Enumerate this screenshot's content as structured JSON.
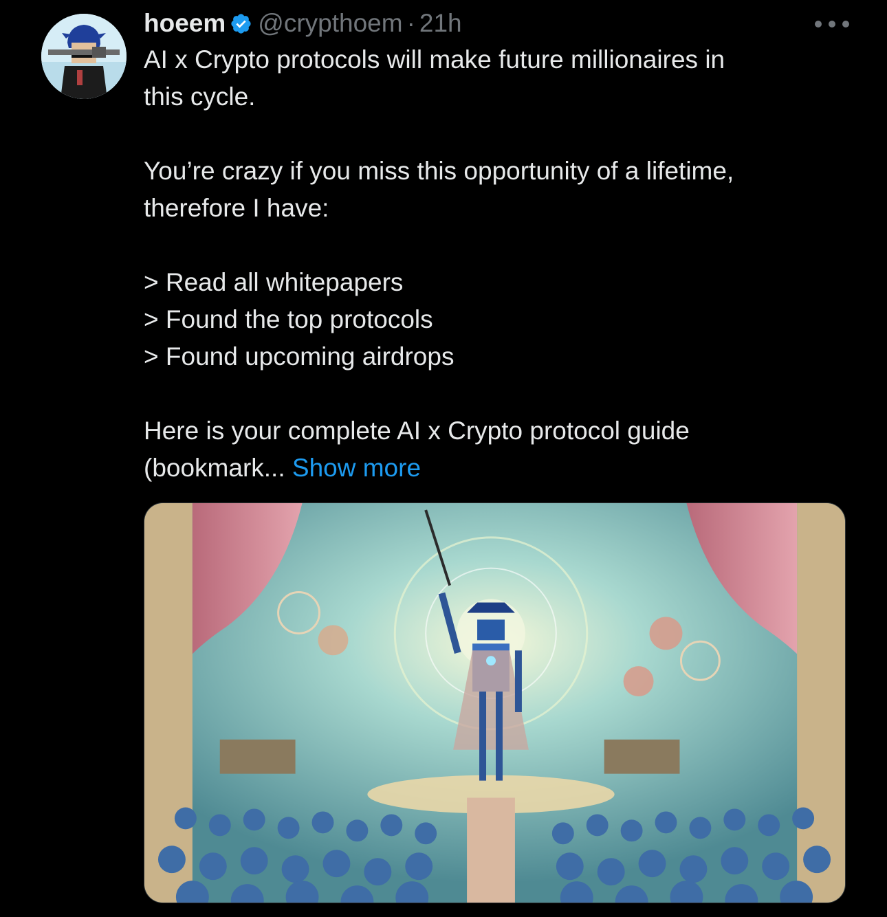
{
  "author": {
    "display_name": "hoeem",
    "handle": "@crypthoem",
    "separator": "·",
    "time": "21h",
    "verified": true
  },
  "tweet": {
    "lines": [
      "AI x Crypto protocols will make future millionaires in",
      "this cycle.",
      "",
      "You’re crazy if you miss this opportunity of a lifetime,",
      "therefore I have:",
      "",
      "> Read all whitepapers",
      "> Found the top protocols",
      "> Found upcoming airdrops",
      "",
      "Here is your complete AI x Crypto protocol guide"
    ],
    "last_line_prefix": "(bookmark...",
    "show_more_label": "Show more"
  },
  "colors": {
    "background": "#000000",
    "text": "#e7e9ea",
    "secondary": "#71767b",
    "link": "#1d9bf0",
    "verified": "#1d9bf0"
  },
  "icons": {
    "verified": "verified-badge-icon",
    "more": "more-dots-icon"
  }
}
